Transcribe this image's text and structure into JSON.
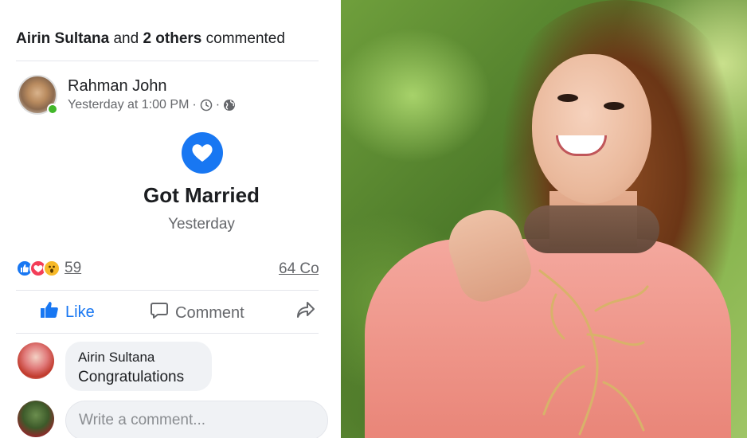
{
  "header": {
    "commenter_name": "Airin Sultana",
    "connector": "and",
    "others": "2 others",
    "action": "commented"
  },
  "post": {
    "author": "Rahman John",
    "timestamp": "Yesterday at 1:00 PM",
    "meta_separator": "·",
    "life_event": {
      "icon": "heart-icon",
      "title": "Got Married",
      "date": "Yesterday"
    },
    "reactions": {
      "types": [
        "like",
        "love",
        "wow"
      ],
      "count": "59"
    },
    "comments_count": "64 Co"
  },
  "actions": {
    "like_label": "Like",
    "comment_label": "Comment"
  },
  "comment": {
    "author": "Airin Sultana",
    "text": "Congratulations"
  },
  "composer": {
    "placeholder": "Write a comment..."
  },
  "colors": {
    "facebook_blue": "#1877f2",
    "online_green": "#42b72a",
    "love_red": "#f33e58",
    "wow_yellow": "#f7b928"
  }
}
